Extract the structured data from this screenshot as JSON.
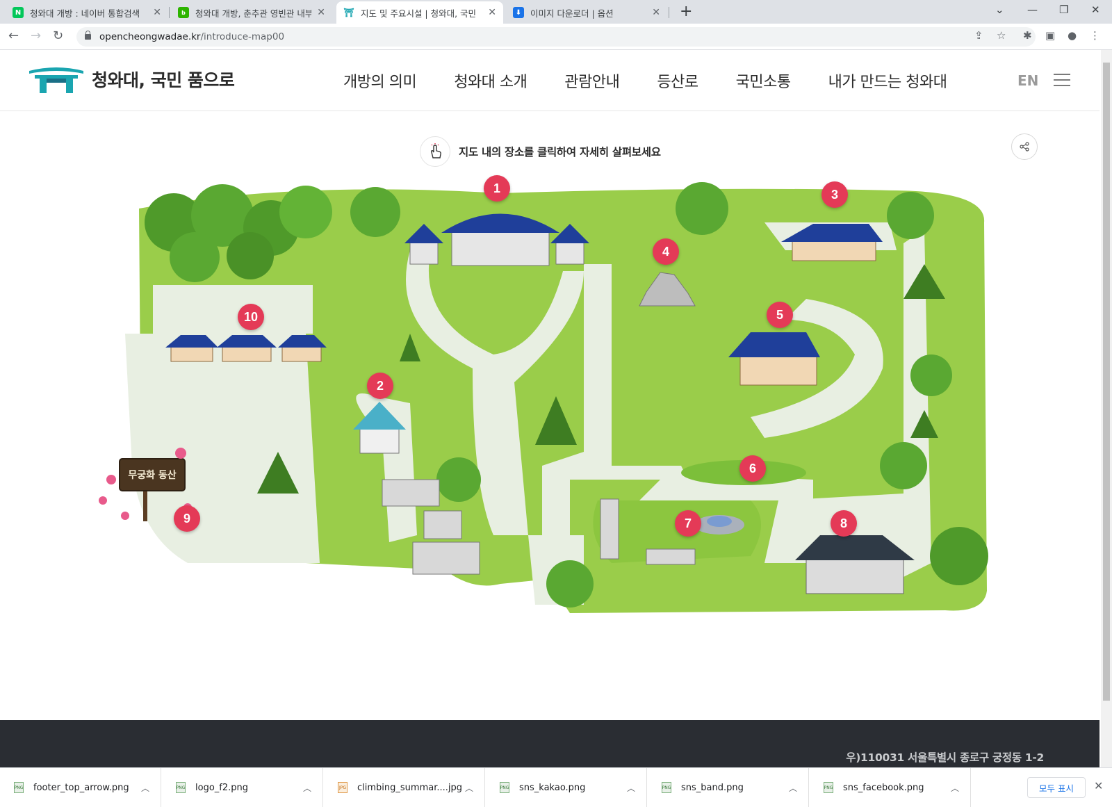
{
  "browser": {
    "tabs": [
      {
        "title": "청와대 개방 : 네이버 통합검색",
        "favicon": "naver-icon",
        "color": "#03c75a",
        "glyph": "N"
      },
      {
        "title": "청와대 개방, 춘추관 영빈관 내부",
        "favicon": "blog-icon",
        "color": "#2db400",
        "glyph": "b"
      },
      {
        "title": "지도 및 주요시설 | 청와대, 국민",
        "favicon": "cheongwadae-icon",
        "color": "#1aa5b0",
        "glyph": "⛩"
      },
      {
        "title": "이미지 다운로더 | 옵션",
        "favicon": "download-icon",
        "color": "#1a73e8",
        "glyph": "⬇"
      }
    ],
    "url_domain": "opencheongwadae.kr",
    "url_path": "/introduce-map00"
  },
  "site": {
    "logo_text": "청와대, 국민 품으로",
    "nav": [
      "개방의 의미",
      "청와대 소개",
      "관람안내",
      "등산로",
      "국민소통",
      "내가 만드는 청와대"
    ],
    "lang": "EN"
  },
  "main": {
    "guide_text": "지도 내의 장소를 클릭하여 자세히 살펴보세요",
    "sign_text": "무궁화 동산",
    "pins": [
      "1",
      "2",
      "3",
      "4",
      "5",
      "6",
      "7",
      "8",
      "9",
      "10"
    ]
  },
  "footer": {
    "address": "우)110031 서울특별시 종로구 궁정동 1-2"
  },
  "downloads": {
    "items": [
      "footer_top_arrow.png",
      "logo_f2.png",
      "climbing_summar....jpg",
      "sns_kakao.png",
      "sns_band.png",
      "sns_facebook.png"
    ],
    "show_all": "모두 표시"
  },
  "colors": {
    "pin": "#e43a57",
    "grass": "#8cc63f",
    "roof": "#1f3f9a",
    "logo": "#1aa5b0",
    "footer": "#2a2d33"
  }
}
